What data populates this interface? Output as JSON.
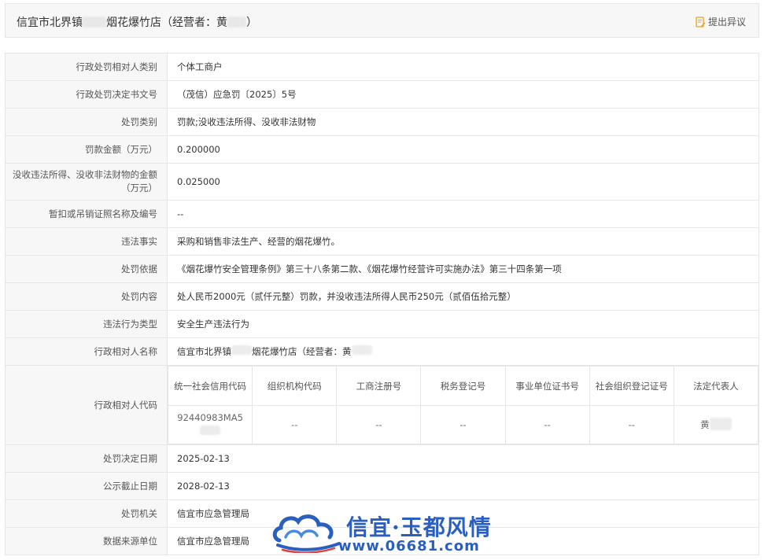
{
  "header": {
    "title_prefix": "信宜市北界镇",
    "title_middle": "烟花爆竹店（经营者：黄",
    "title_suffix": "）",
    "objection_label": "提出异议",
    "accent_color": "#f0a020"
  },
  "rows": [
    {
      "label": "行政处罚相对人类别",
      "value": "个体工商户"
    },
    {
      "label": "行政处罚决定书文号",
      "value": "（茂信）应急罚〔2025〕5号"
    },
    {
      "label": "处罚类别",
      "value": "罚款;没收违法所得、没收非法财物"
    },
    {
      "label": "罚款金额（万元）",
      "value": "0.200000"
    },
    {
      "label": "没收违法所得、没收非法财物的金额（万元）",
      "value": "0.025000"
    },
    {
      "label": "暂扣或吊销证照名称及编号",
      "value": "--"
    },
    {
      "label": "违法事实",
      "value": "采购和销售非法生产、经营的烟花爆竹。"
    },
    {
      "label": "处罚依据",
      "value": "《烟花爆竹安全管理条例》第三十八条第二款、《烟花爆竹经营许可实施办法》第三十四条第一项"
    },
    {
      "label": "处罚内容",
      "value": "处人民币2000元（贰仟元整）罚款，并没收违法所得人民币250元（贰佰伍拾元整）"
    },
    {
      "label": "违法行为类型",
      "value": "安全生产违法行为"
    },
    {
      "label": "行政相对人名称",
      "value_prefix": "信宜市北界镇",
      "value_middle": "烟花爆竹店（经营者：黄"
    }
  ],
  "code_row": {
    "label": "行政相对人代码",
    "headers": [
      "统一社会信用代码",
      "组织机构代码",
      "工商注册号",
      "税务登记号",
      "事业单位证书号",
      "社会组织登记证号",
      "法定代表人"
    ],
    "values": [
      "92440983MA5",
      "--",
      "--",
      "--",
      "--",
      "--",
      "黄"
    ]
  },
  "tail_rows": [
    {
      "label": "处罚决定日期",
      "value": "2025-02-13"
    },
    {
      "label": "公示截止日期",
      "value": "2028-02-13"
    },
    {
      "label": "处罚机关",
      "value": "信宜市应急管理局"
    },
    {
      "label": "数据来源单位",
      "value": "信宜市应急管理局"
    }
  ],
  "watermark": {
    "title": "信宜·玉都风情",
    "url": "www.06681.com",
    "logo_icon": "cloud-logo-icon"
  }
}
